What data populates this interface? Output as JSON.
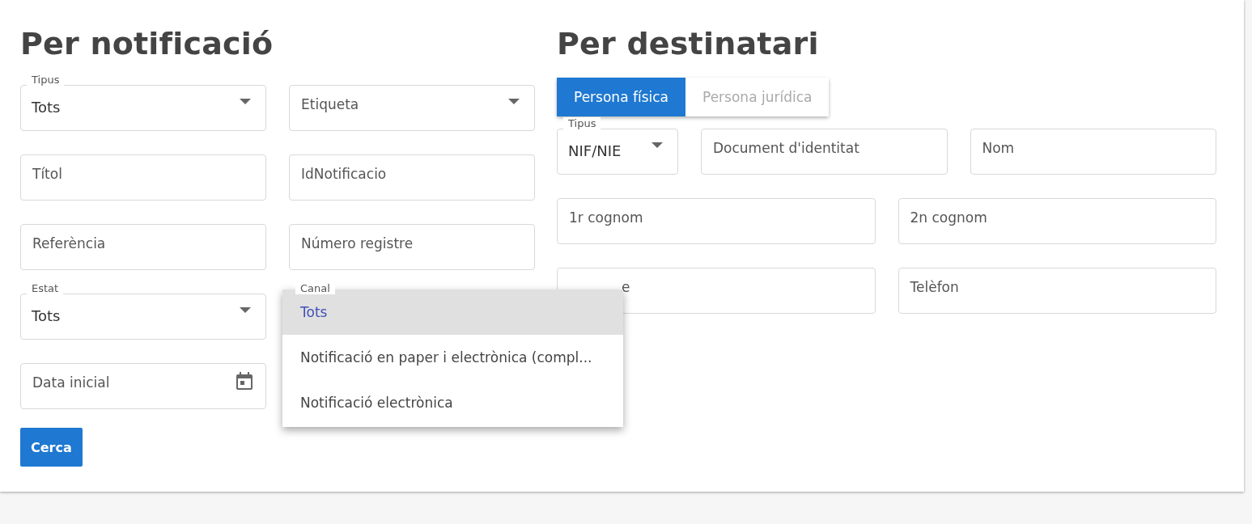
{
  "by_notification": {
    "title": "Per notificació",
    "fields": [
      {
        "kind": "select",
        "label": "Tipus",
        "value": "Tots"
      },
      {
        "kind": "select",
        "placeholder": "Etiqueta"
      },
      {
        "kind": "text",
        "placeholder": "Títol"
      },
      {
        "kind": "text",
        "placeholder": "IdNotificacio"
      },
      {
        "kind": "text",
        "placeholder": "Referència"
      },
      {
        "kind": "text",
        "placeholder": "Número registre"
      },
      {
        "kind": "select",
        "label": "Estat",
        "value": "Tots"
      },
      {
        "kind": "under-menu",
        "label": "Canal"
      },
      {
        "kind": "date",
        "placeholder": "Data inicial"
      }
    ],
    "search_button": "Cerca"
  },
  "canal_menu": [
    {
      "label": "Tots",
      "selected": true
    },
    {
      "label": "Notificació en paper i electrònica (compl...",
      "selected": false
    },
    {
      "label": "Notificació electrònica",
      "selected": false
    }
  ],
  "by_recipient": {
    "title": "Per destinatari",
    "tabs": [
      {
        "label": "Persona física",
        "selected": true
      },
      {
        "label": "Persona jurídica",
        "selected": false
      }
    ],
    "rows": [
      [
        {
          "kind": "select",
          "label": "Tipus",
          "value": "NIF/NIE"
        },
        {
          "kind": "text",
          "placeholder": "Document d'identitat"
        },
        {
          "kind": "text",
          "placeholder": "Nom"
        }
      ],
      [
        {
          "kind": "text",
          "placeholder": "1r cognom"
        },
        {
          "kind": "text",
          "placeholder": "2n cognom"
        }
      ],
      [
        {
          "kind": "covered",
          "placeholder": "e"
        },
        {
          "kind": "text",
          "placeholder": "Telèfon"
        }
      ]
    ]
  }
}
